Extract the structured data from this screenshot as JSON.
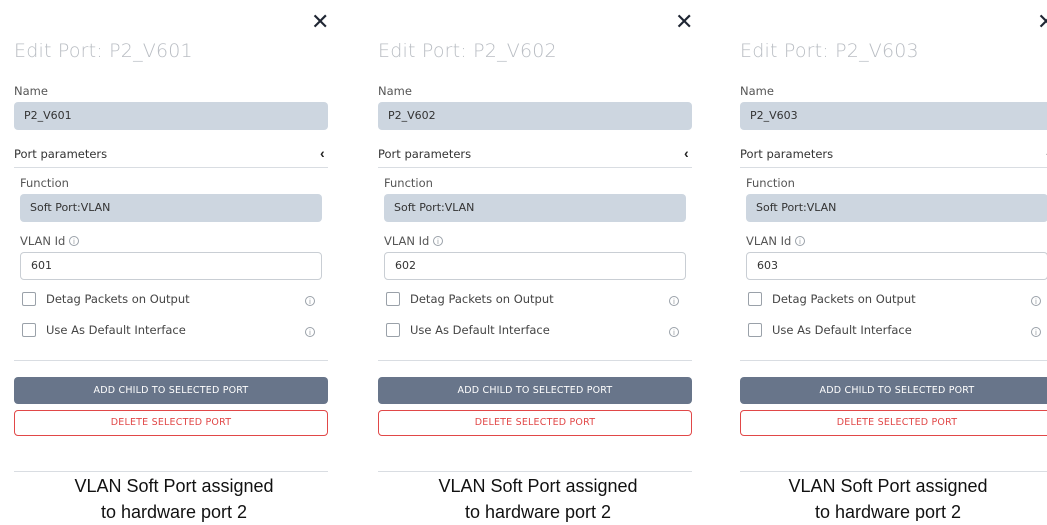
{
  "panels": [
    {
      "title": "Edit Port: P2_V601",
      "name_label": "Name",
      "name_value": "P2_V601",
      "section_label": "Port parameters",
      "function_label": "Function",
      "function_value": "Soft Port:VLAN",
      "vlan_label": "VLAN Id",
      "vlan_value": "601",
      "detag_label": "Detag Packets on Output",
      "default_label": "Use As Default Interface",
      "add_button": "ADD CHILD TO SELECTED PORT",
      "delete_button": "DELETE SELECTED PORT",
      "caption_line1": "VLAN Soft Port assigned",
      "caption_line2": "to hardware port 2"
    },
    {
      "title": "Edit Port: P2_V602",
      "name_label": "Name",
      "name_value": "P2_V602",
      "section_label": "Port parameters",
      "function_label": "Function",
      "function_value": "Soft Port:VLAN",
      "vlan_label": "VLAN Id",
      "vlan_value": "602",
      "detag_label": "Detag Packets on Output",
      "default_label": "Use As Default Interface",
      "add_button": "ADD CHILD TO SELECTED PORT",
      "delete_button": "DELETE SELECTED PORT",
      "caption_line1": "VLAN Soft Port assigned",
      "caption_line2": "to hardware port 2"
    },
    {
      "title": "Edit Port: P2_V603",
      "name_label": "Name",
      "name_value": "P2_V603",
      "section_label": "Port parameters",
      "function_label": "Function",
      "function_value": "Soft Port:VLAN",
      "vlan_label": "VLAN Id",
      "vlan_value": "603",
      "detag_label": "Detag Packets on Output",
      "default_label": "Use As Default Interface",
      "add_button": "ADD CHILD TO SELECTED PORT",
      "delete_button": "DELETE SELECTED PORT",
      "caption_line1": "VLAN Soft Port assigned",
      "caption_line2": "to hardware port 2"
    }
  ],
  "icons": {
    "close": "close-icon",
    "collapse": "chevron-left-icon",
    "info": "info-icon"
  },
  "colors": {
    "readonly_field": "#cdd6e0",
    "add_button": "#68758a",
    "delete_button": "#e14848",
    "title": "#b9bdc3"
  }
}
